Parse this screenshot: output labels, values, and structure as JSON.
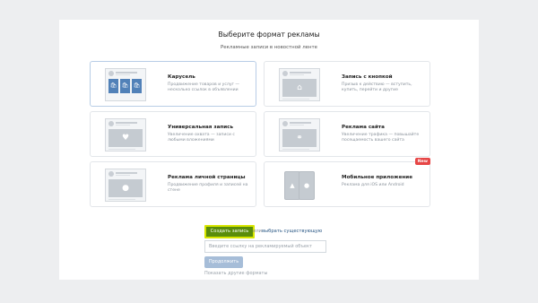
{
  "header": {
    "title": "Выберите формат рекламы",
    "subtitle": "Рекламные записи в новостной ленте"
  },
  "formats": [
    {
      "title": "Карусель",
      "description": "Продвижение товаров и услуг — несколько ссылок в объявлении",
      "icon": "carousel-icon"
    },
    {
      "title": "Запись с кнопкой",
      "description": "Призыв к действию — вступить, купить, перейти и другие",
      "icon": "home-icon"
    },
    {
      "title": "Универсальная запись",
      "description": "Увеличение охвата — записи с любыми вложениями",
      "icon": "heart-icon"
    },
    {
      "title": "Реклама сайта",
      "description": "Увеличение трафика — повышайте посещаемость вашего сайта",
      "icon": "link-icon"
    },
    {
      "title": "Реклама личной страницы",
      "description": "Продвижение профиля и записей на стене",
      "icon": "person-icon"
    },
    {
      "title": "Мобильное приложение",
      "description": "Реклама для iOS или Android",
      "icon": "phone-icon",
      "badge": "New"
    }
  ],
  "actions": {
    "create_label": "Создать запись",
    "or_text": "или",
    "existing_link": "выбрать существующую",
    "url_placeholder": "Введите ссылку на рекламируемый объект",
    "continue_label": "Продолжить",
    "other_formats": "Показать другие форматы"
  },
  "colors": {
    "accent_green": "#5a8d0a",
    "highlight": "#d8e600",
    "link": "#2a5885",
    "carousel_blue": "#5181b8",
    "badge_red": "#e64646"
  }
}
